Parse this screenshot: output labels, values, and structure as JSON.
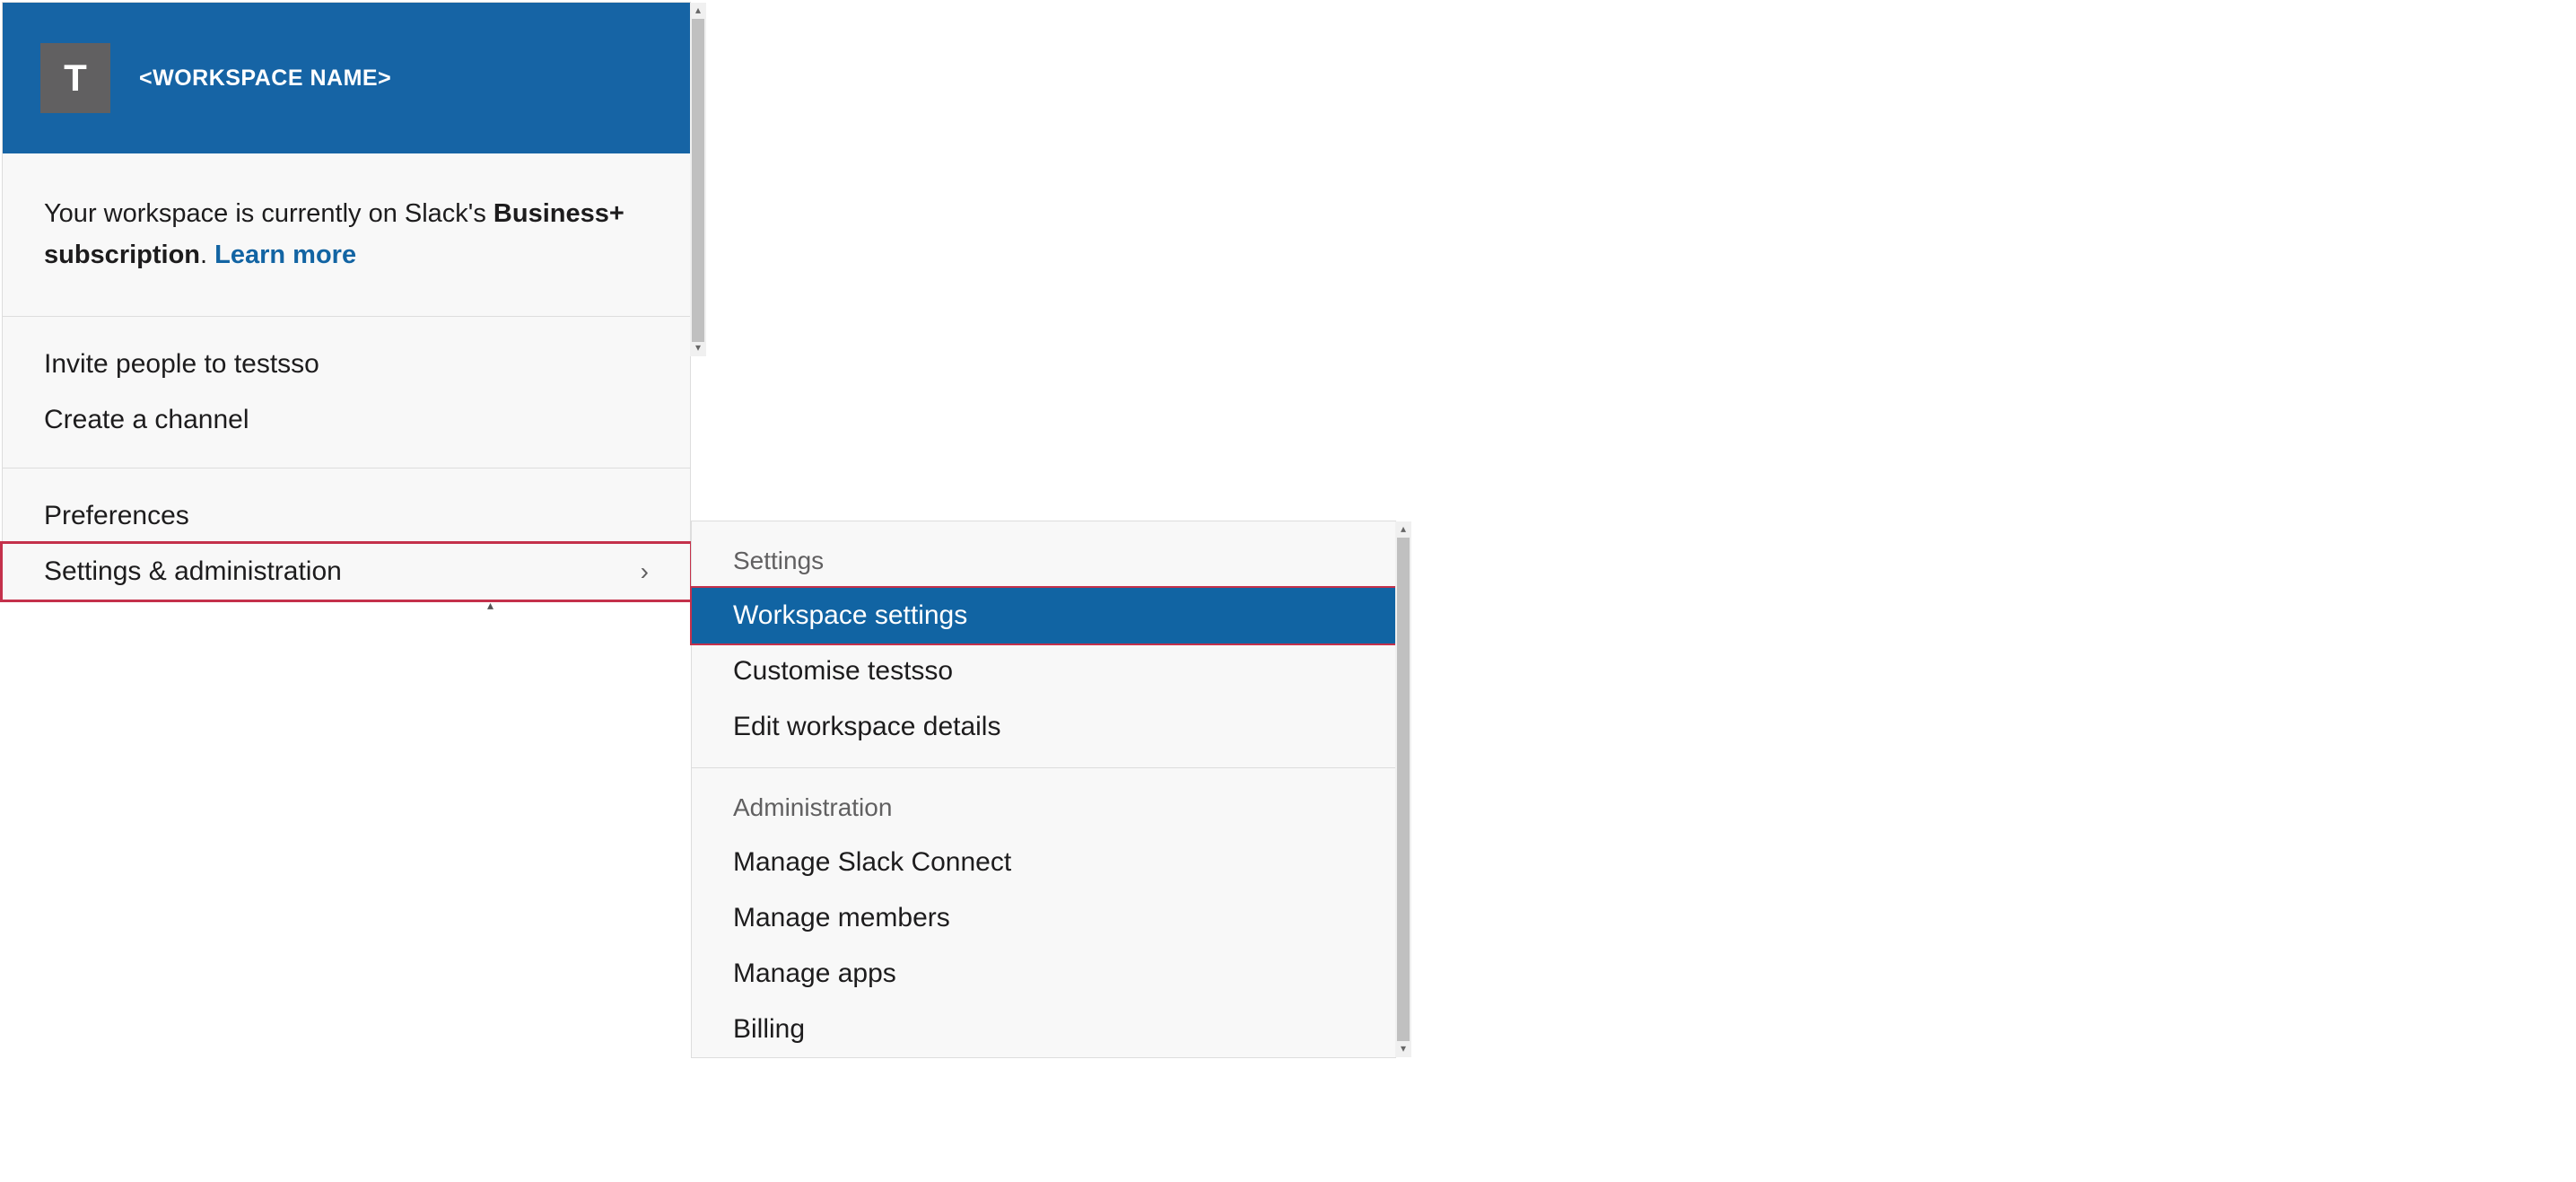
{
  "header": {
    "workspace_initial": "T",
    "workspace_name": "<WORKSPACE NAME>"
  },
  "notice": {
    "prefix": "Your workspace is currently on Slack's ",
    "bold": "Business+ subscription",
    "period": ". ",
    "link": "Learn more"
  },
  "menu": {
    "sections": [
      {
        "items": [
          {
            "label": "Invite people to testsso",
            "chevron": false
          },
          {
            "label": "Create a channel",
            "chevron": false
          }
        ]
      },
      {
        "items": [
          {
            "label": "Preferences",
            "chevron": false
          },
          {
            "label": "Settings & administration",
            "chevron": true,
            "highlighted": true
          }
        ]
      }
    ]
  },
  "submenu": {
    "sections": [
      {
        "header": "Settings",
        "items": [
          {
            "label": "Workspace settings",
            "active": true
          },
          {
            "label": "Customise testsso",
            "active": false
          },
          {
            "label": "Edit workspace details",
            "active": false
          }
        ]
      },
      {
        "header": "Administration",
        "items": [
          {
            "label": "Manage Slack Connect",
            "active": false
          },
          {
            "label": "Manage members",
            "active": false
          },
          {
            "label": "Manage apps",
            "active": false
          },
          {
            "label": "Billing",
            "active": false
          }
        ]
      }
    ]
  }
}
